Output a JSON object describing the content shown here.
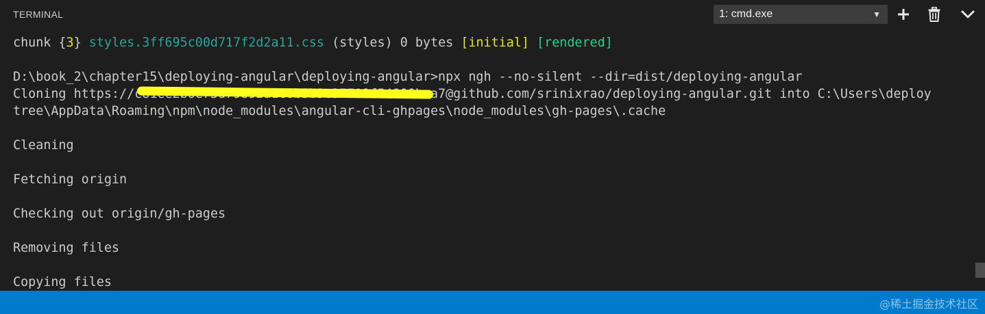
{
  "panel": {
    "title": "TERMINAL",
    "selected_terminal": "1: cmd.exe",
    "actions": {
      "new_terminal_icon": "plus-icon",
      "kill_terminal_icon": "trash-icon",
      "collapse_icon": "chevron-down-icon"
    }
  },
  "terminal": {
    "line1": {
      "prefix": "chunk {",
      "chunk_id": "3",
      "after_id": "} ",
      "file": "styles.3ff695c00d717f2d2a11.css",
      "middle": " (styles) 0 bytes ",
      "initial": "[initial]",
      "space": " ",
      "rendered": "[rendered]"
    },
    "command": "D:\\book_2\\chapter15\\deploying-angular\\deploying-angular>npx ngh --no-silent --dir=dist/deploying-angular",
    "cloning_1": "Cloning https://c81ee2b6e73d79892a1c6b3b9c37719f54800baa7@github.com/srinixrao/deploying-angular.git into C:\\Users\\deploy",
    "cloning_2": "tree\\AppData\\Roaming\\npm\\node_modules\\angular-cli-ghpages\\node_modules\\gh-pages\\.cache",
    "cleaning": "Cleaning",
    "fetching": "Fetching origin",
    "checking_out": "Checking out origin/gh-pages",
    "removing": "Removing files",
    "copying": "Copying files"
  },
  "colors": {
    "background": "#1e1e1e",
    "status_bar": "#007acc",
    "yellow": "#e5e510",
    "green": "#23d18b"
  },
  "watermark": "@稀土掘金技术社区"
}
